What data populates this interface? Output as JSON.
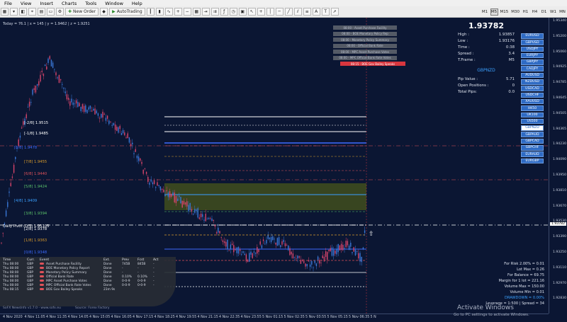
{
  "menu": [
    "File",
    "View",
    "Insert",
    "Charts",
    "Tools",
    "Window",
    "Help"
  ],
  "toolbar": {
    "new_order": "New Order",
    "autotrading": "AutoTrading"
  },
  "timeframes": [
    "M1",
    "M5",
    "M15",
    "M30",
    "H1",
    "H4",
    "D1",
    "W1",
    "MN"
  ],
  "active_timeframe": "M5",
  "info_line": "Today = 76.1  |  x = 145  |  y = 1.9462  |  z = 1.9251",
  "levels": [
    {
      "label": "[-2/8]  1.9515",
      "color": "#ffffff"
    },
    {
      "label": "[-1/8]  1.9485",
      "color": "#ffffff"
    },
    {
      "label": "[8/8]  1.9478",
      "color": "#3d6bff"
    },
    {
      "label": "[7/8]  1.9455",
      "color": "#d99b2b"
    },
    {
      "label": "[6/8]  1.9440",
      "color": "#e0525a"
    },
    {
      "label": "[5/8]  1.9424",
      "color": "#5cc36a"
    },
    {
      "label": "[4/8]  1.9409",
      "color": "#3aa0ff"
    },
    {
      "label": "[3/8]  1.9394",
      "color": "#5cc36a"
    },
    {
      "label": "[2/8]  1.9378",
      "color": "#ffffff"
    },
    {
      "label": "[1/8]  1.9363",
      "color": "#d99b2b"
    },
    {
      "label": "[0/8]  1.9348",
      "color": "#3d6bff"
    }
  ],
  "news_boxes": [
    "08:00 - Asset Purchase Facility",
    "08:00 - BOE Monetary Policy Rep",
    "08:00 - Monetary Policy Summary",
    "08:00 - Official Bank Rate",
    "08:00 - MPC Asset Purchase Votes",
    "08:00 - MPC Official Bank Rate Votes",
    "08:15 - BOE Gov Bailey Speaks"
  ],
  "panel": {
    "price": "1.93782",
    "rows": [
      {
        "label": "High :",
        "value": "1.93857"
      },
      {
        "label": "Low :",
        "value": "1.93176"
      },
      {
        "label": "Time :",
        "value": "0:38"
      },
      {
        "label": "Spread :",
        "value": "3.4"
      },
      {
        "label": "T.Frame :",
        "value": "M5"
      }
    ],
    "symbol": "GBPNZD",
    "rows2": [
      {
        "label": "Pip Value :",
        "value": "5.71"
      },
      {
        "label": "Open Positions :",
        "value": "0"
      },
      {
        "label": "Total Pips:",
        "value": "0.0"
      }
    ]
  },
  "symbols": [
    "EURUSD",
    "GBPUSD",
    "USDJPY",
    "EURJPY",
    "GBPJPY",
    "CADJPY",
    "AUDUSD",
    "NZDUSD",
    "USDCAD",
    "USDCHF",
    "XAUUSD",
    "HK50",
    "UK100",
    "US500",
    "GBPNZD",
    "GBPAUD",
    "GBPCAD",
    "GBPCHF",
    "EURAUD",
    "EURGBP"
  ],
  "selected_symbol": "GBPNZD",
  "news_table": {
    "headers": [
      "Time",
      "Curr.",
      "Event",
      "Ext.",
      "Prev",
      "Fcst",
      "Act"
    ],
    "rows": [
      {
        "time": "Thu  08:00",
        "cur": "GBP",
        "event": "Asset Purchase Facility",
        "ext": "Done",
        "prev": "745B",
        "fcst": "845B",
        "act": "-",
        "impact": "#e0525a"
      },
      {
        "time": "Thu  08:00",
        "cur": "GBP",
        "event": "BOE Monetary Policy Report",
        "ext": "Done",
        "prev": "-",
        "fcst": "-",
        "act": "-",
        "impact": "#e0525a"
      },
      {
        "time": "Thu  08:00",
        "cur": "GBP",
        "event": "Monetary Policy Summary",
        "ext": "Done",
        "prev": "-",
        "fcst": "-",
        "act": "-",
        "impact": "#e0525a"
      },
      {
        "time": "Thu  08:00",
        "cur": "GBP",
        "event": "Official Bank Rate",
        "ext": "Done",
        "prev": "0.10%",
        "fcst": "0.10%",
        "act": "-",
        "impact": "#e0525a"
      },
      {
        "time": "Thu  08:00",
        "cur": "GBP",
        "event": "MPC Asset Purchase Votes",
        "ext": "Done",
        "prev": "0-0-9",
        "fcst": "0-0-9",
        "act": "-",
        "impact": "#e0525a"
      },
      {
        "time": "Thu  08:00",
        "cur": "GBP",
        "event": "MPC Official Bank Rate Votes",
        "ext": "Done",
        "prev": "0-0-9",
        "fcst": "0-0-9",
        "act": "-",
        "impact": "#e0525a"
      },
      {
        "time": "Thu  08:15",
        "cur": "GBP",
        "event": "BOE Gov Bailey Speaks",
        "ext": "23m 9s",
        "prev": "",
        "fcst": "",
        "act": "",
        "impact": "#e0525a"
      }
    ]
  },
  "risk": [
    {
      "text": "For Risk 2.00% = 0.01",
      "blue": false
    },
    {
      "text": "Lot Max = 0.26",
      "blue": false
    },
    {
      "text": "For Balance = 69.75",
      "blue": false
    },
    {
      "text": "Margin for 1 lot = 221.16",
      "blue": false
    },
    {
      "text": "Volume Max = 150.00",
      "blue": false
    },
    {
      "text": "Volume Min = 0.01",
      "blue": false
    },
    {
      "text": "DRAWDOWN = 0.00%",
      "blue": true
    },
    {
      "text": "Leverage = 1:500 | Spread = 34",
      "blue": false
    }
  ],
  "yaxis_ticks": [
    "1.95340",
    "1.95200",
    "1.95060",
    "1.94925",
    "1.94785",
    "1.94645",
    "1.94505",
    "1.94365",
    "1.94230",
    "1.94090",
    "1.93950",
    "1.93810",
    "1.93670",
    "1.93530",
    "1.93390",
    "1.93250",
    "1.93110",
    "1.92970",
    "1.92830"
  ],
  "current_price_tag": "1.93782",
  "xaxis_ticks": [
    "4 Nov 2020",
    "4 Nov 11:05",
    "4 Nov 11:35",
    "4 Nov 14:05",
    "4 Nov 15:05",
    "4 Nov 16:05",
    "4 Nov 17:15",
    "4 Nov 18:25",
    "4 Nov 19:55",
    "4 Nov 21:15",
    "4 Nov 22:35",
    "4 Nov 23:55",
    "5 Nov 01:15",
    "5 Nov 02:35",
    "5 Nov 03:55",
    "5 Nov 05:15",
    "5 Nov 06:35",
    "5 N"
  ],
  "footer_left": "SoFX NewsInfo v1.7.0  -  www.sofx.eu",
  "footer_mid": "Source: Forex Factory",
  "watermark": "Activate Windows",
  "watermark_sub": "Go to PC settings to activate Windows.",
  "pivot_note": "Daily Pivot (D/S) 1.95105",
  "colors": {
    "background": "#0b1633",
    "bull": "#3a78d8",
    "bear": "#d8456b",
    "zone": "#4c5a18"
  }
}
